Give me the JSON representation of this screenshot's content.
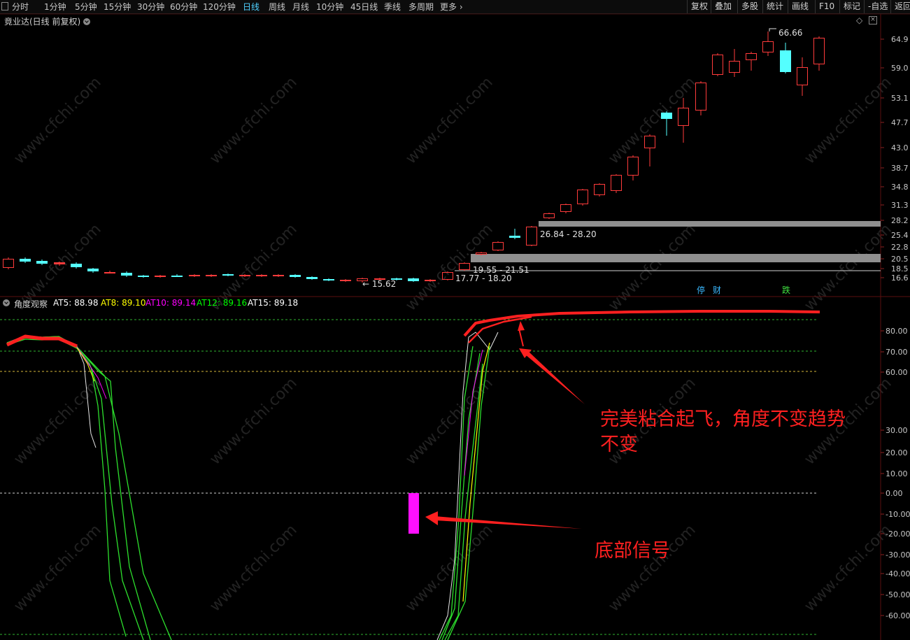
{
  "toolbar": {
    "left_items": [
      "分时",
      "1分钟",
      "5分钟",
      "15分钟",
      "30分钟",
      "60分钟",
      "120分钟",
      "日线",
      "周线",
      "月线",
      "10分钟",
      "45日线",
      "季线",
      "多周期",
      "更多"
    ],
    "active": "日线",
    "right_items": [
      "复权",
      "叠加",
      "多股",
      "统计",
      "画线",
      "F10",
      "标记",
      "-自选",
      "返回"
    ]
  },
  "title": "竟业达(日线 前复权)",
  "price_axis": [
    "64.9",
    "59.0",
    "53.1",
    "47.7",
    "43.0",
    "38.7",
    "34.8",
    "31.3",
    "28.2",
    "25.4",
    "22.8",
    "20.5",
    "18.5",
    "16.6"
  ],
  "price_annotations": {
    "high": "66.66",
    "low": "15.62",
    "zone1": "26.84 - 28.20",
    "zone2": "19.55 - 21.51",
    "zone3": "17.77 - 18.20"
  },
  "tags": {
    "t1": "停",
    "t2": "财",
    "t3": "跌"
  },
  "indicator": {
    "name": "角度观察",
    "at5": "AT5: 88.98",
    "at8": "AT8: 89.10",
    "at10": "AT10: 89.14",
    "at12": "AT12: 89.16",
    "at15": "AT15: 89.18",
    "colors": {
      "at5": "#ffffff",
      "at8": "#ffff00",
      "at10": "#ff00ff",
      "at12": "#00ff00",
      "at15": "#ffffff"
    }
  },
  "ind_axis": [
    "80.00",
    "70.00",
    "60.00",
    "30.00",
    "20.00",
    "10.00",
    "0.00",
    "-10.00",
    "-20.00",
    "-30.00",
    "-40.00",
    "-50.00",
    "-60.00"
  ],
  "notes": {
    "flyoff_line1": "完美粘合起飞，角度不变趋势",
    "flyoff_line2": "不变",
    "bottom_signal": "底部信号"
  },
  "watermark": "www.cfchi.com"
}
